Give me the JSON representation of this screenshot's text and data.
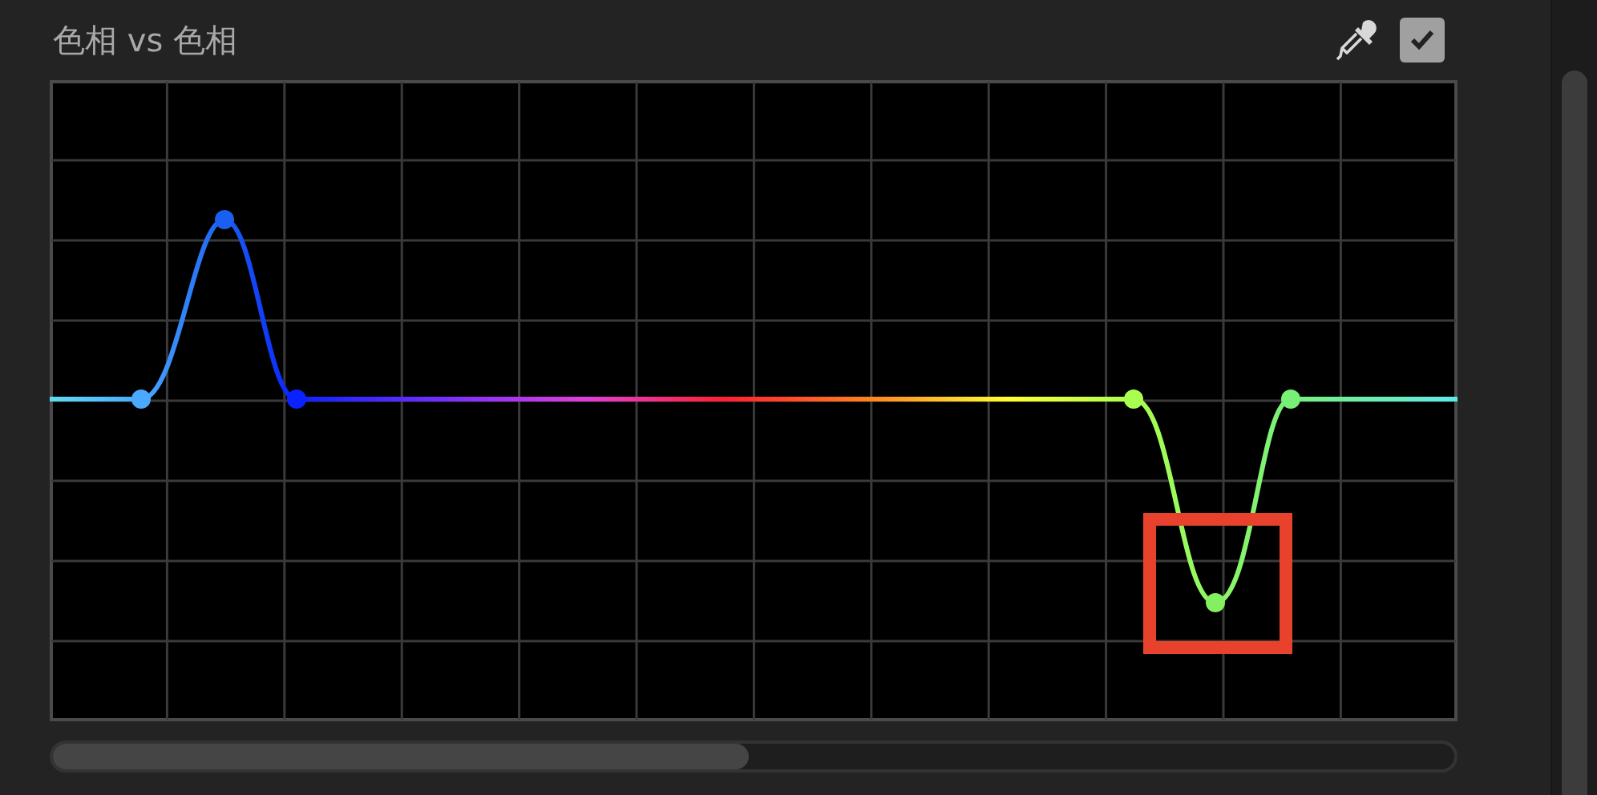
{
  "panel": {
    "title": "色相 vs 色相"
  },
  "checkbox": {
    "checked": true
  }
}
